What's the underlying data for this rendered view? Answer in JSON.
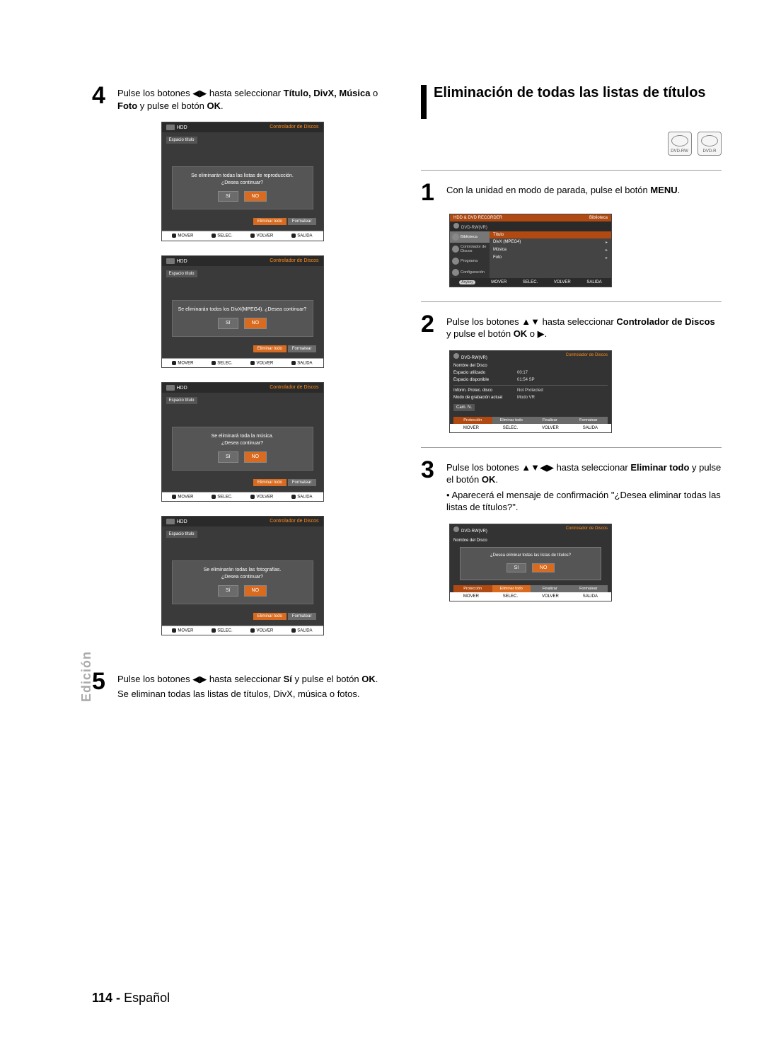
{
  "left": {
    "step4": {
      "num": "4",
      "text_before": "Pulse los botones ",
      "arrows": "◀▶",
      "text_mid": " hasta seleccionar ",
      "bold1": "Título, DivX, Música",
      "text_mid2": " o ",
      "bold2": "Foto",
      "text_after": " y pulse el botón ",
      "bold3": "OK",
      "period": "."
    },
    "shots": [
      {
        "hdr_left": "HDD",
        "hdr_right": "Controlador de Discos",
        "espacio": "Espacio título",
        "msg1": "Se eliminarán todas las listas de reproducción.",
        "msg2": "¿Desea continuar?",
        "si": "Sí",
        "no": "NO",
        "tabs": [
          "Eliminar todo",
          "Formatear"
        ]
      },
      {
        "hdr_left": "HDD",
        "hdr_right": "Controlador de Discos",
        "espacio": "Espacio título",
        "msg1": "Se eliminarán todos los DivX(MPEG4). ¿Desea continuar?",
        "msg2": "",
        "si": "Sí",
        "no": "NO",
        "tabs": [
          "Eliminar todo",
          "Formatear"
        ]
      },
      {
        "hdr_left": "HDD",
        "hdr_right": "Controlador de Discos",
        "espacio": "Espacio título",
        "msg1": "Se eliminará toda la música.",
        "msg2": "¿Desea continuar?",
        "si": "Sí",
        "no": "NO",
        "tabs": [
          "Eliminar todo",
          "Formatear"
        ]
      },
      {
        "hdr_left": "HDD",
        "hdr_right": "Controlador de Discos",
        "espacio": "Espacio título",
        "msg1": "Se eliminarán todas las fotografías.",
        "msg2": "¿Desea continuar?",
        "si": "Sí",
        "no": "NO",
        "tabs": [
          "Eliminar todo",
          "Formatear"
        ]
      }
    ],
    "foot": {
      "mover": "MOVER",
      "selec": "SELEC.",
      "volver": "VOLVER",
      "salida": "SALIDA"
    },
    "step5": {
      "num": "5",
      "text_before": "Pulse los botones ",
      "arrows": "◀▶",
      "text_mid": " hasta seleccionar ",
      "bold1": "Sí",
      "text_after": " y pulse el botón ",
      "bold2": "OK",
      "period": ".",
      "sub": "Se eliminan todas las listas de títulos, DivX, música o fotos."
    }
  },
  "right": {
    "title": "Eliminación de todas las listas de títulos",
    "discs": [
      "DVD-RW",
      "DVD-R"
    ],
    "step1": {
      "num": "1",
      "text_before": "Con la unidad en modo de parada, pulse el botón ",
      "bold": "MENU",
      "period": "."
    },
    "menu_shot": {
      "top_left": "HDD & DVD RECORDER",
      "top_right": "Biblioteca",
      "device": "DVD-RW(VR)",
      "side": [
        "Biblioteca",
        "Controlador de Discos",
        "Programa",
        "Configuración"
      ],
      "main_hdr": "Título",
      "main": [
        "DivX (MPEG4)",
        "Música",
        "Foto"
      ],
      "anykey": "Anykey",
      "foot": [
        "MOVER",
        "SELEC.",
        "VOLVER",
        "SALIDA"
      ]
    },
    "step2": {
      "num": "2",
      "text_before": "Pulse los botones ",
      "arrows": "▲▼",
      "text_mid": " hasta seleccionar ",
      "bold1": "Controlador de Discos",
      "text_after": " y pulse el botón ",
      "bold2": "OK",
      "tail": " o ",
      "arrow_tail": "▶",
      "period": "."
    },
    "info_shot": {
      "top_left": "DVD-RW(VR)",
      "top_right": "Controlador de Discos",
      "rows": [
        {
          "k": "Nombre del Disco",
          "v": ""
        },
        {
          "k": "Espacio utilizado",
          "v": "00:17"
        },
        {
          "k": "Espacio disponible",
          "v": "01:54 SP"
        },
        {
          "k": "Inform. Protec. disco",
          "v": "Not Protected"
        },
        {
          "k": "Modo de grabación actual",
          "v": "Modo VR"
        }
      ],
      "camn": "Cam. N.",
      "tabs": [
        "Protección",
        "Eliminar todo",
        "Finalizar",
        "Formatear"
      ],
      "foot": [
        "MOVER",
        "SELEC.",
        "VOLVER",
        "SALIDA"
      ]
    },
    "step3": {
      "num": "3",
      "text_before": "Pulse los botones ",
      "arrows": "▲▼◀▶",
      "text_mid": " hasta seleccionar ",
      "bold1": "Eliminar todo",
      "text_after": " y pulse el botón ",
      "bold2": "OK",
      "period": ".",
      "bullet": "Aparecerá el mensaje de confirmación \"¿Desea eliminar todas las listas de títulos?\"."
    },
    "conf_shot": {
      "top_left": "DVD-RW(VR)",
      "top_right": "Controlador de Discos",
      "nombre": "Nombre del Disco",
      "msg": "¿Desea eliminar todas las listas de títulos?",
      "si": "Sí",
      "no": "NO",
      "tabs": [
        "Protección",
        "Eliminar todo",
        "Finalizar",
        "Formatear"
      ],
      "foot": [
        "MOVER",
        "SELEC.",
        "VOLVER",
        "SALIDA"
      ]
    }
  },
  "side_tab": "Edición",
  "footer": {
    "num": "114 -",
    "lang": "Español"
  }
}
